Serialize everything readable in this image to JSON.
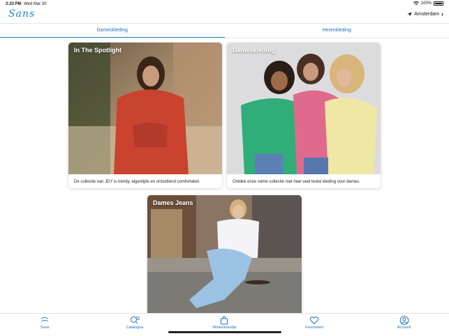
{
  "statusbar": {
    "time": "3:23 PM",
    "date": "Wed Mar 30",
    "battery": "100%",
    "battery_level": 1.0
  },
  "header": {
    "logo": "Sans",
    "location": "Amsterdam"
  },
  "tabs": [
    {
      "label": "Dameskleding",
      "active": true
    },
    {
      "label": "Herenkleding",
      "active": false
    }
  ],
  "cards": [
    {
      "title": "In The Spotlight",
      "description": "De collectie van JDY is trendy, eigentijds en ontzettend comfortabel."
    },
    {
      "title": "Dameskleding",
      "description": "Ontdek onze ruime collectie met heel veel leuke kleding voor dames."
    },
    {
      "title": "Dames Jeans",
      "description": ""
    }
  ],
  "tabbar": [
    {
      "label": "Sans",
      "icon": "sans-logo-icon"
    },
    {
      "label": "Catalogus",
      "icon": "search-list-icon"
    },
    {
      "label": "Winkelmandje",
      "icon": "shopping-bag-icon"
    },
    {
      "label": "Favorieten",
      "icon": "heart-icon"
    },
    {
      "label": "Account",
      "icon": "user-circle-icon"
    }
  ],
  "colors": {
    "accent": "#1e88c9",
    "tab_text": "#1e6fb8"
  }
}
